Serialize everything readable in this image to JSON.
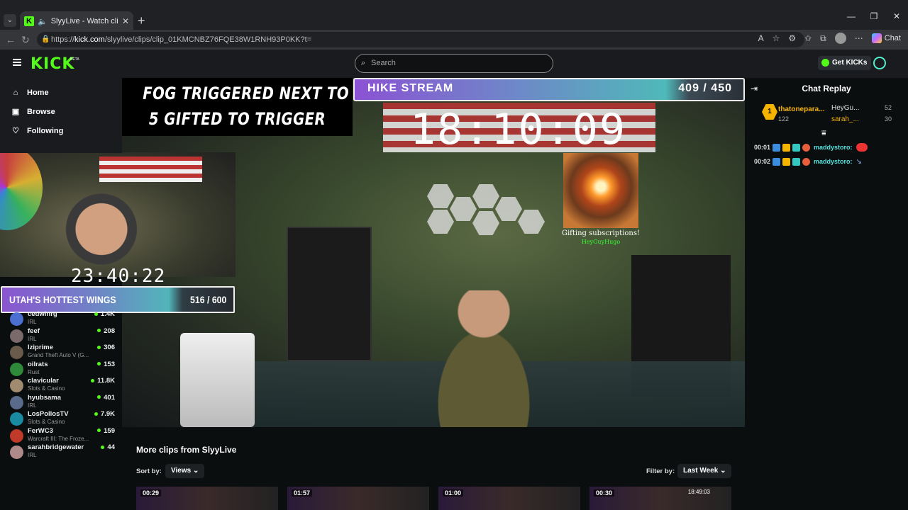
{
  "browser": {
    "tab_title": "SlyyLive - Watch clips on Kick",
    "url_prefix": "https://",
    "url_host": "kick.com",
    "url_path": "/slyylive/clips/clip_01KMCNBZ76FQE38W1RNH93P0KK?t=",
    "copilot_label": "Chat"
  },
  "header": {
    "logo": "KICK",
    "beta": "BETA",
    "search_placeholder": "Search",
    "get_kicks": "Get KICKs"
  },
  "sidebar": {
    "nav": [
      {
        "icon": "home-icon",
        "label": "Home"
      },
      {
        "icon": "browse-icon",
        "label": "Browse"
      },
      {
        "icon": "heart-icon",
        "label": "Following"
      }
    ],
    "channels": [
      {
        "name": "cedwinrg",
        "category": "IRL",
        "viewers": "1.4K",
        "color": "#4a6fd0"
      },
      {
        "name": "feef",
        "category": "IRL",
        "viewers": "208",
        "color": "#7a6a6a"
      },
      {
        "name": "lziprime",
        "category": "Grand Theft Auto V (G...",
        "viewers": "306",
        "color": "#6a5a4a"
      },
      {
        "name": "oilrats",
        "category": "Rust",
        "viewers": "153",
        "color": "#2e8a3a"
      },
      {
        "name": "clavicular",
        "category": "Slots & Casino",
        "viewers": "11.8K",
        "color": "#a08a70"
      },
      {
        "name": "hyubsama",
        "category": "IRL",
        "viewers": "401",
        "color": "#5a6a8a"
      },
      {
        "name": "LosPollosTV",
        "category": "Slots & Casino",
        "viewers": "7.9K",
        "color": "#1a8aa0"
      },
      {
        "name": "FerWC3",
        "category": "Warcraft III: The Froze...",
        "viewers": "159",
        "color": "#c03a2a"
      },
      {
        "name": "sarahbridgewater",
        "category": "IRL",
        "viewers": "44",
        "color": "#b08a8a"
      }
    ]
  },
  "overlay": {
    "fog_line1": "FOG TRIGGERED NEXT TO SLYY",
    "fog_line2": "5 GIFTED TO TRIGGER",
    "hike_title": "HIKE STREAM",
    "hike_count": "409 / 450",
    "hike_progress": 0.909,
    "big_timer": "18:10:09",
    "gift_text": "Gifting subscriptions!",
    "gift_user": "HeyGuyHugo",
    "small_timer": "23:40:22",
    "wings_title": "UTAH'S HOTTEST WINGS",
    "wings_count": "516 / 600",
    "wings_progress": 0.86
  },
  "chat": {
    "title": "Chat Replay",
    "top_gifter_rank": "1",
    "top_gifter_name": "thatonepara...",
    "top_gifter_count": "122",
    "gifter2_name": "HeyGu...",
    "gifter2_count": "52",
    "gifter3_name": "sarah_...",
    "gifter3_count": "30",
    "messages": [
      {
        "time": "00:01",
        "user": "maddystoro:"
      },
      {
        "time": "00:02",
        "user": "maddystoro:"
      }
    ]
  },
  "clips": {
    "title": "More clips from SlyyLive",
    "sort_label": "Sort by:",
    "sort_value": "Views",
    "filter_label": "Filter by:",
    "filter_value": "Last Week",
    "thumbs": [
      {
        "duration": "00:29",
        "extra": ""
      },
      {
        "duration": "01:57",
        "extra": ""
      },
      {
        "duration": "01:00",
        "extra": ""
      },
      {
        "duration": "00:30",
        "extra": "18:49:03"
      }
    ]
  }
}
